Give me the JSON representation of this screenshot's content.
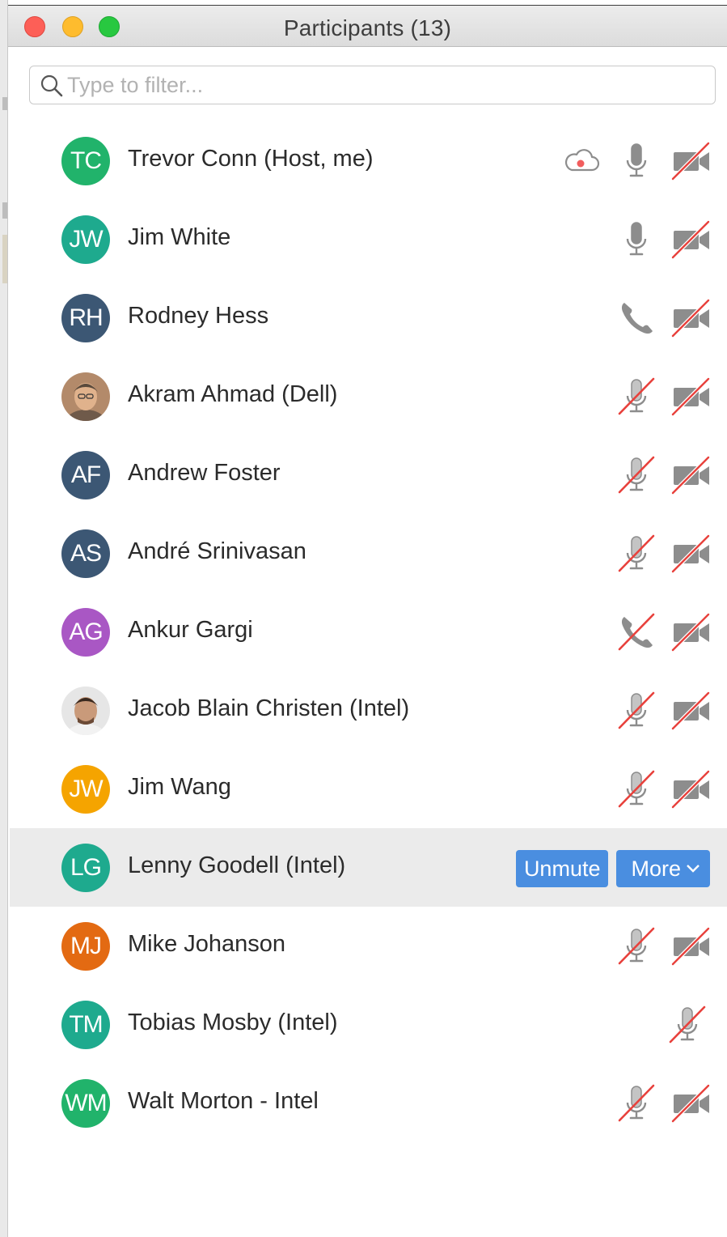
{
  "window": {
    "title": "Participants (13)"
  },
  "search": {
    "placeholder": "Type to filter...",
    "value": ""
  },
  "colors": {
    "accent_button": "#4a8ee0",
    "muted_slash": "#e8413c",
    "icon_gray": "#8d8d8d",
    "selected_row": "#ebebeb"
  },
  "participants": [
    {
      "initials": "TC",
      "name": "Trevor Conn (Host, me)",
      "avatar_color": "#21b36b",
      "avatar_type": "initials",
      "recording": true,
      "audio": "mic-on",
      "video": "off"
    },
    {
      "initials": "JW",
      "name": "Jim White",
      "avatar_color": "#1eaa8e",
      "avatar_type": "initials",
      "recording": false,
      "audio": "mic-on",
      "video": "off"
    },
    {
      "initials": "RH",
      "name": "Rodney Hess",
      "avatar_color": "#3c5774",
      "avatar_type": "initials",
      "recording": false,
      "audio": "phone",
      "video": "off"
    },
    {
      "initials": "",
      "name": "Akram Ahmad (Dell)",
      "avatar_color": "#c79a7c",
      "avatar_type": "photo",
      "recording": false,
      "audio": "mic-muted",
      "video": "off"
    },
    {
      "initials": "AF",
      "name": "Andrew Foster",
      "avatar_color": "#3c5774",
      "avatar_type": "initials",
      "recording": false,
      "audio": "mic-muted",
      "video": "off"
    },
    {
      "initials": "AS",
      "name": "André Srinivasan",
      "avatar_color": "#3c5774",
      "avatar_type": "initials",
      "recording": false,
      "audio": "mic-muted",
      "video": "off"
    },
    {
      "initials": "AG",
      "name": "Ankur Gargi",
      "avatar_color": "#a957c4",
      "avatar_type": "initials",
      "recording": false,
      "audio": "phone-muted",
      "video": "off"
    },
    {
      "initials": "",
      "name": "Jacob Blain Christen (Intel)",
      "avatar_color": "#9a7a63",
      "avatar_type": "photo",
      "recording": false,
      "audio": "mic-muted",
      "video": "off"
    },
    {
      "initials": "JW",
      "name": "Jim Wang",
      "avatar_color": "#f5a400",
      "avatar_type": "initials",
      "recording": false,
      "audio": "mic-muted",
      "video": "off"
    },
    {
      "initials": "LG",
      "name": "Lenny Goodell (Intel)",
      "avatar_color": "#1eaa8e",
      "avatar_type": "initials",
      "recording": false,
      "audio": "buttons",
      "video": "buttons",
      "selected": true
    },
    {
      "initials": "MJ",
      "name": "Mike Johanson",
      "avatar_color": "#e36a12",
      "avatar_type": "initials",
      "recording": false,
      "audio": "mic-muted",
      "video": "off"
    },
    {
      "initials": "TM",
      "name": "Tobias Mosby (Intel)",
      "avatar_color": "#1eaa8e",
      "avatar_type": "initials",
      "recording": false,
      "audio": "mic-muted",
      "video": "none"
    },
    {
      "initials": "WM",
      "name": "Walt Morton - Intel",
      "avatar_color": "#21b36b",
      "avatar_type": "initials",
      "recording": false,
      "audio": "mic-muted",
      "video": "off"
    }
  ],
  "actions": {
    "unmute_label": "Unmute",
    "more_label": "More"
  },
  "icons": {
    "search": "search-icon",
    "cloud": "cloud-record-icon",
    "mic": "microphone-icon",
    "mic_muted": "microphone-muted-icon",
    "phone": "phone-icon",
    "phone_muted": "phone-muted-icon",
    "video_off": "video-off-icon",
    "chevron": "chevron-down-icon"
  }
}
